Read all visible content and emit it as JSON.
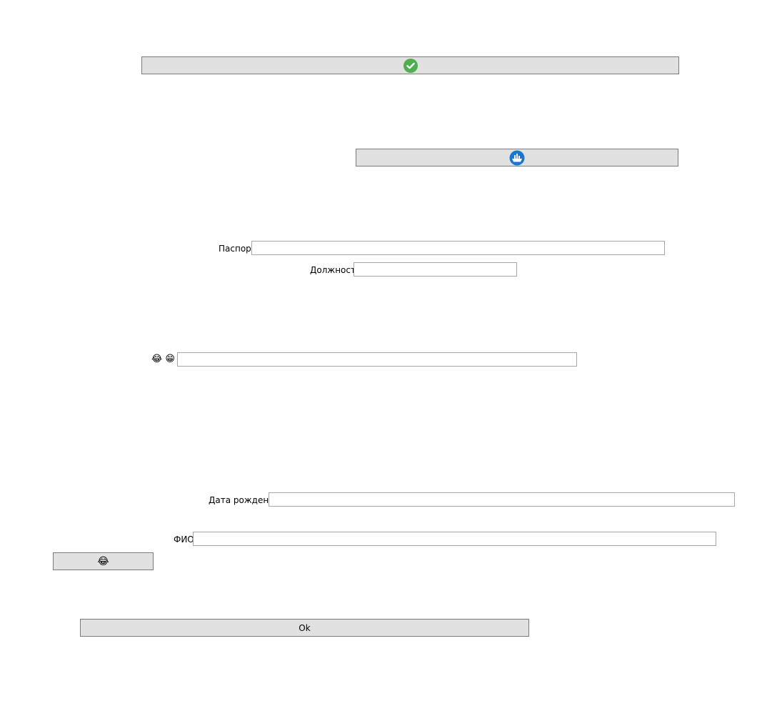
{
  "buttons": {
    "top_icon": "check-circle-icon",
    "second_icon": "boat-circle-icon",
    "small_icon": "laughing-tears-icon",
    "ok_label": "Ok"
  },
  "fields": {
    "passport_label": "Паспорт",
    "passport_value": "",
    "position_label": "Должность",
    "position_value": "",
    "emoji_row_label": "😂 😁",
    "emoji_row_value": "",
    "birthdate_label": "Дата рождения",
    "birthdate_value": "",
    "fio_label": "ФИО",
    "fio_value": ""
  },
  "colors": {
    "button_bg": "#e1e1e1",
    "button_border": "#7a7a7a",
    "check_green": "#4caf50",
    "boat_blue": "#1976d2"
  }
}
